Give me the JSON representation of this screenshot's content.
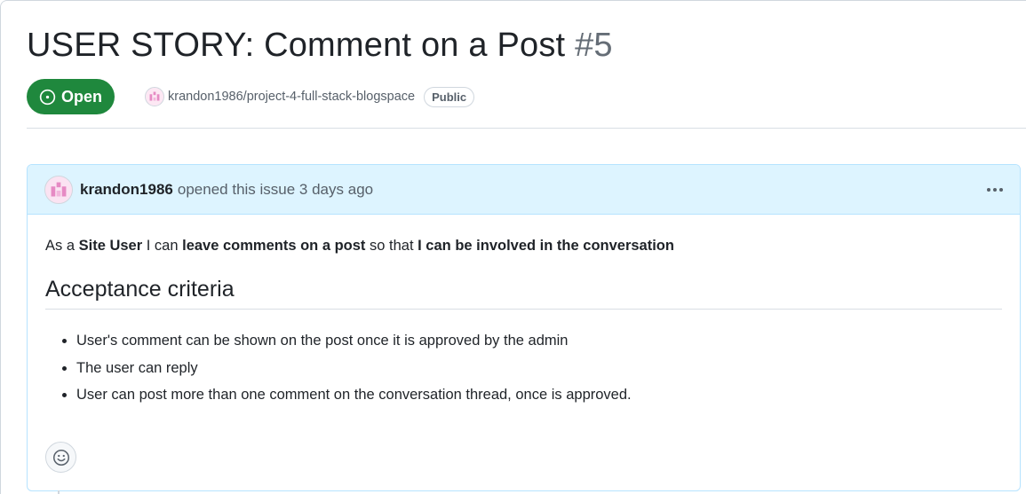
{
  "issue": {
    "title": "USER STORY: Comment on a Post",
    "number": "#5",
    "state": "Open",
    "repo": "krandon1986/project-4-full-stack-blogspace",
    "visibility": "Public"
  },
  "comment": {
    "author": "krandon1986",
    "action_text": "opened this issue 3 days ago",
    "body": {
      "intro_prefix": "As a ",
      "role": "Site User",
      "mid1": " I can ",
      "action": "leave comments on a post",
      "mid2": " so that ",
      "goal": "I can be involved in the conversation"
    },
    "heading": "Acceptance criteria",
    "criteria": [
      "User's comment can be shown on the post once it is approved by the admin",
      "The user can reply",
      "User can post more than one comment on the conversation thread, once is approved."
    ]
  },
  "colors": {
    "open_green": "#1f883d",
    "header_blue": "#ddf4ff",
    "header_border": "#b6e3ff"
  },
  "icons": {
    "state": "issue-opened-icon",
    "more": "kebab-horizontal-icon",
    "reaction": "smiley-icon"
  }
}
